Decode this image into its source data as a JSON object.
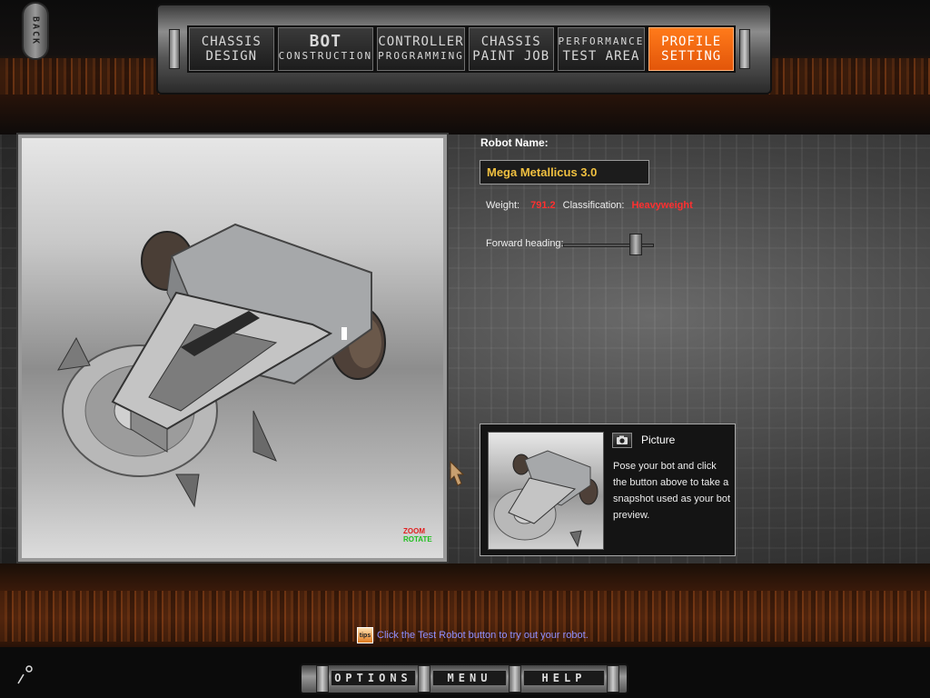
{
  "back": {
    "label": "BACK"
  },
  "nav": {
    "tabs": [
      {
        "line1": "CHASSIS",
        "line2": "DESIGN",
        "active": false
      },
      {
        "line1": "BOT",
        "line2": "CONSTRUCTION",
        "active": false
      },
      {
        "line1": "CONTROLLER",
        "line2": "PROGRAMMING",
        "active": false
      },
      {
        "line1": "CHASSIS",
        "line2": "PAINT JOB",
        "active": false
      },
      {
        "line1": "PERFORMANCE",
        "line2": "TEST AREA",
        "active": false
      },
      {
        "line1": "PROFILE",
        "line2": "SETTING",
        "active": true
      }
    ]
  },
  "viewport": {
    "zoom_label": "ZOOM",
    "rotate_label": "ROTATE"
  },
  "profile": {
    "name_label": "Robot Name:",
    "name_value": "Mega Metallicus 3.0",
    "weight_label": "Weight:",
    "weight_value": "791.2",
    "classification_label": "Classification:",
    "classification_value": "Heavyweight",
    "heading_label": "Forward heading:",
    "heading_level": 0.85
  },
  "picture": {
    "title": "Picture",
    "description": "Pose your bot and click the button above to take a snapshot used as your bot preview."
  },
  "hint": {
    "icon_text": "tips",
    "text": "Click the Test Robot button to try out your robot."
  },
  "footer": {
    "options": "OPTIONS",
    "menu": "MENU",
    "help": "HELP"
  },
  "colors": {
    "accent": "#f26a12",
    "name_text": "#f0c040",
    "stat_value": "#ff3030",
    "hint_text": "#8f8fff"
  }
}
